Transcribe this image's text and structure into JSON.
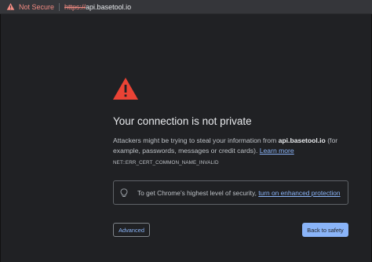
{
  "address_bar": {
    "security_label": "Not Secure",
    "url_scheme": "https://",
    "url_host": "api.basetool.io"
  },
  "interstitial": {
    "title": "Your connection is not private",
    "body_prefix": "Attackers might be trying to steal your information from ",
    "body_host": "api.basetool.io",
    "body_suffix": " (for example, passwords, messages or credit cards). ",
    "learn_more": "Learn more",
    "error_code": "NET::ERR_CERT_COMMON_NAME_INVALID",
    "security_prefix": "To get Chrome’s highest level of security, ",
    "security_link": "turn on enhanced protection",
    "advanced_button": "Advanced",
    "back_button": "Back to safety"
  },
  "colors": {
    "background": "#202124",
    "warning_red": "#ea4335",
    "link_blue": "#8ab4f8"
  },
  "icons": {
    "address_warning": "warning-triangle-icon",
    "page_warning": "warning-triangle-icon",
    "security_tip": "lightbulb-icon"
  }
}
